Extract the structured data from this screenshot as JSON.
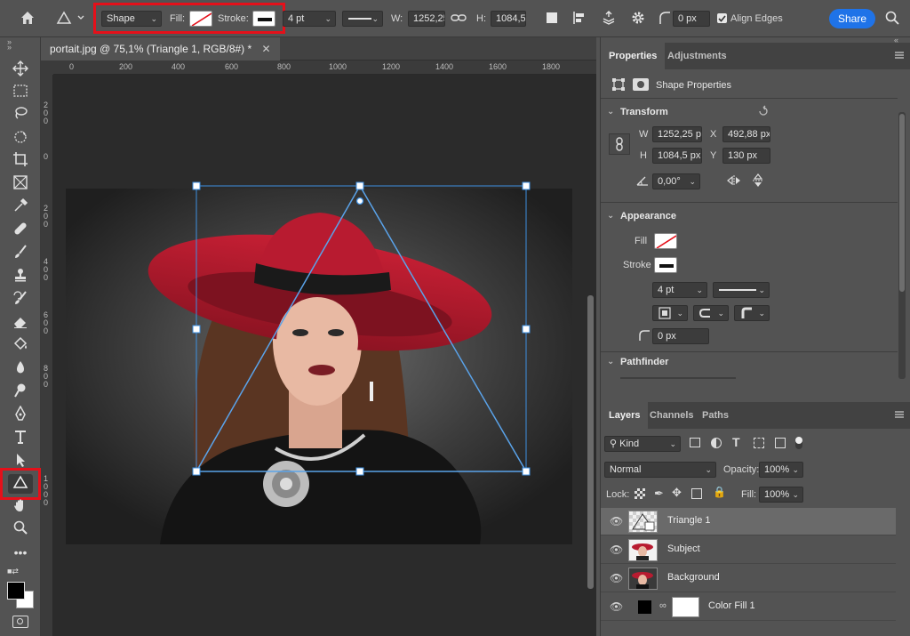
{
  "options_bar": {
    "mode": "Shape",
    "fill_label": "Fill:",
    "stroke_label": "Stroke:",
    "stroke_width": "4 pt",
    "w_label": "W:",
    "w_value": "1252,25",
    "h_label": "H:",
    "h_value": "1084,5",
    "radius_value": "0 px",
    "align_edges_label": "Align Edges",
    "share_label": "Share"
  },
  "document": {
    "tab_title": "portait.jpg @ 75,1% (Triangle 1, RGB/8#) *",
    "ruler_top_ticks": [
      "0",
      "200",
      "400",
      "600",
      "800",
      "1000",
      "1200",
      "1400",
      "1600",
      "1800"
    ],
    "ruler_left_ticks": [
      "2\n0\n0",
      "0",
      "2\n0\n0",
      "4\n0\n0",
      "6\n0\n0",
      "8\n0\n0",
      "1\n0\n0\n0"
    ]
  },
  "properties_panel": {
    "tabs": [
      "Properties",
      "Adjustments"
    ],
    "subtitle": "Shape Properties",
    "transform": {
      "title": "Transform",
      "w_label": "W",
      "w": "1252,25 px",
      "x_label": "X",
      "x": "492,88 px",
      "h_label": "H",
      "h": "1084,5 px",
      "y_label": "Y",
      "y": "130 px",
      "angle": "0,00°"
    },
    "appearance": {
      "title": "Appearance",
      "fill_label": "Fill",
      "stroke_label": "Stroke",
      "stroke_width": "4 pt",
      "radius": "0 px"
    },
    "pathfinder_title": "Pathfinder"
  },
  "layers_panel": {
    "tabs": [
      "Layers",
      "Channels",
      "Paths"
    ],
    "filter_kind": "Kind",
    "blend_mode": "Normal",
    "opacity_label": "Opacity:",
    "opacity": "100%",
    "lock_label": "Lock:",
    "fill_label": "Fill:",
    "fill": "100%",
    "layers": [
      "Triangle 1",
      "Subject",
      "Background",
      "Color Fill 1"
    ]
  },
  "colors": {
    "accent": "#1f73e8",
    "highlight": "#e5101a",
    "selection": "#3d8fe0"
  }
}
